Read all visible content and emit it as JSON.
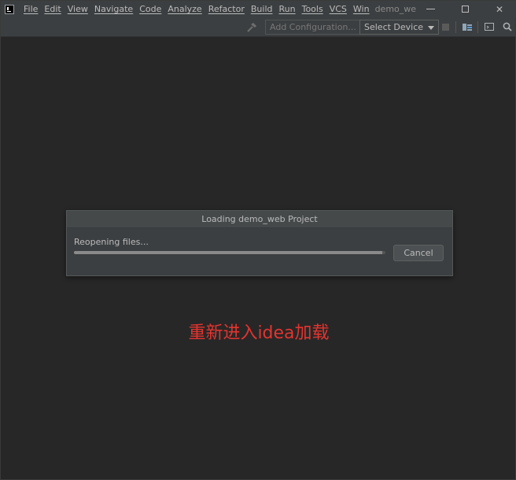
{
  "menu": {
    "items": [
      "File",
      "Edit",
      "View",
      "Navigate",
      "Code",
      "Analyze",
      "Refactor",
      "Build",
      "Run",
      "Tools",
      "VCS",
      "Win"
    ],
    "project_title": "demo_we"
  },
  "window_controls": {
    "close": "✕"
  },
  "toolbar": {
    "add_configuration": "Add Configuration...",
    "select_device": "Select Device"
  },
  "dialog": {
    "title": "Loading demo_web Project",
    "status": "Reopening files...",
    "progress_percent": 99,
    "cancel_label": "Cancel"
  },
  "annotation": {
    "text": "重新进入idea加载",
    "color": "#e3342f"
  }
}
